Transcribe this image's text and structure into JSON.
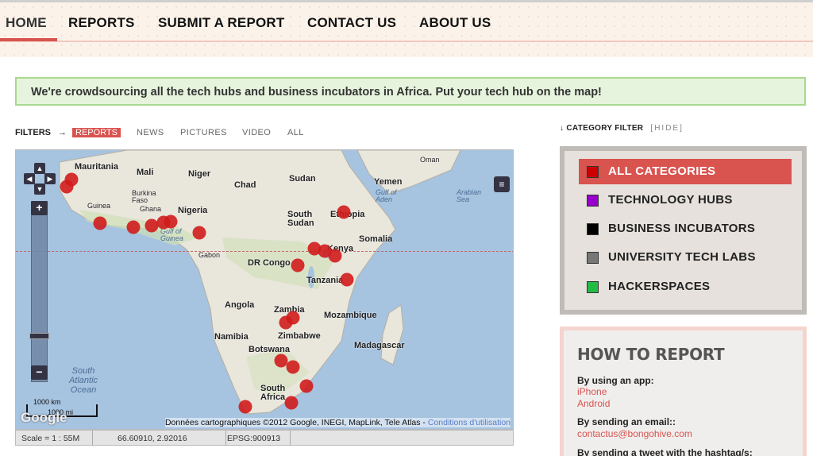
{
  "nav": {
    "items": [
      "HOME",
      "REPORTS",
      "SUBMIT A REPORT",
      "CONTACT US",
      "ABOUT US"
    ],
    "active_index": 0,
    "accent": "#d9534f"
  },
  "banner": {
    "text": "We're crowdsourcing all the tech hubs and business incubators in Africa. Put your tech hub on the map!"
  },
  "filters": {
    "label": "FILTERS",
    "arrow": "→",
    "options": [
      "REPORTS",
      "NEWS",
      "PICTURES",
      "VIDEO",
      "ALL"
    ],
    "active": "REPORTS"
  },
  "map": {
    "places": [
      "Mauritania",
      "Mali",
      "Niger",
      "Chad",
      "Sudan",
      "Oman",
      "Yemen",
      "Burkina Faso",
      "Guinea",
      "Ghana",
      "Nigeria",
      "South Sudan",
      "Ethiopia",
      "Somalia",
      "Gabon",
      "DR Congo",
      "Kenya",
      "Tanzania",
      "Angola",
      "Zambia",
      "Mozambique",
      "Zimbabwe",
      "Namibia",
      "Madagascar",
      "Botswana",
      "South Africa"
    ],
    "small_places": [
      "Gulf of Aden",
      "Arabian Sea",
      "Gulf of Guinea"
    ],
    "ocean_label": "South Atlantic Ocean",
    "scale_km": "1000 km",
    "scale_mi": "1000 mi",
    "logo": "Google",
    "credits": "Données cartographiques ©2012 Google, INEGI, MapLink, Tele Atlas - ",
    "credits_link": "Conditions d'utilisation",
    "zoom_in": "+",
    "zoom_out": "−",
    "marker_color": "#d01c1c"
  },
  "statusbar": {
    "scale": "Scale = 1 : 55M",
    "coords": "66.60910, 2.92016",
    "epsg": "EPSG:900913"
  },
  "category_filter": {
    "title": "CATEGORY FILTER",
    "hide_label": "[HIDE]",
    "categories": [
      {
        "label": "ALL CATEGORIES",
        "color": "#cc0000",
        "active": true
      },
      {
        "label": "TECHNOLOGY HUBS",
        "color": "#9900cc",
        "active": false
      },
      {
        "label": "BUSINESS INCUBATORS",
        "color": "#000000",
        "active": false
      },
      {
        "label": "UNIVERSITY TECH LABS",
        "color": "#777777",
        "active": false
      },
      {
        "label": "HACKERSPACES",
        "color": "#22bb44",
        "active": false
      }
    ]
  },
  "how_to_report": {
    "title": "HOW TO REPORT",
    "app_label": "By using an app:",
    "app_links": [
      "iPhone",
      "Android"
    ],
    "email_label": "By sending an email::",
    "email": "contactus@bongohive.com",
    "tweet_label": "By sending a tweet with the hashtag/s:"
  }
}
